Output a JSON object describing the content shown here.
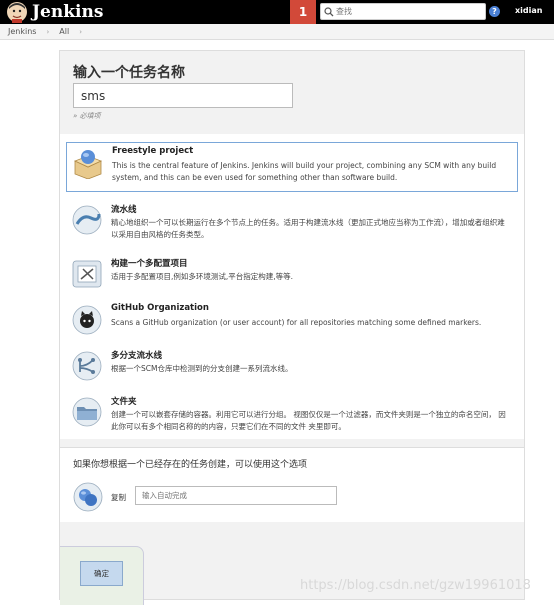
{
  "header": {
    "brand": "Jenkins",
    "notification_count": "1",
    "search_placeholder": "查找",
    "help": "?",
    "user": "xidian"
  },
  "breadcrumb": [
    "Jenkins",
    "All"
  ],
  "form": {
    "title": "输入一个任务名称",
    "name_value": "sms",
    "required_note": "» 必填项"
  },
  "job_types": [
    {
      "name": "Freestyle project",
      "description": "This is the central feature of Jenkins. Jenkins will build your project, combining any SCM with any build system, and this can be even used for something other than software build.",
      "icon": "freestyle-box-icon"
    },
    {
      "name": "流水线",
      "description": "精心地组织一个可以长期运行在多个节点上的任务。适用于构建流水线（更加正式地应当称为工作流），增加或者组织难以采用自由风格的任务类型。",
      "icon": "pipeline-icon"
    },
    {
      "name": "构建一个多配置项目",
      "description": "适用于多配置项目,例如多环境测试,平台指定构建,等等.",
      "icon": "multi-config-icon"
    },
    {
      "name": "GitHub Organization",
      "description": "Scans a GitHub organization (or user account) for all repositories matching some defined markers.",
      "icon": "github-icon"
    },
    {
      "name": "多分支流水线",
      "description": "根据一个SCM仓库中检测到的分支创建一系列流水线。",
      "icon": "multibranch-icon"
    },
    {
      "name": "文件夹",
      "description": "创建一个可以嵌套存储的容器。利用它可以进行分组。 视图仅仅是一个过滤器，而文件夹则是一个独立的命名空间， 因此你可以有多个相同名称的的内容，只要它们在不同的文件 夹里即可。",
      "icon": "folder-icon"
    }
  ],
  "copy": {
    "hint": "如果你想根据一个已经存在的任务创建，可以使用这个选项",
    "label": "复制",
    "placeholder": "输入自动完成"
  },
  "ok_label": "确定",
  "watermark": "https://blog.csdn.net/gzw19961018",
  "colors": {
    "header_bg": "#000000",
    "notification_bg": "#d24939",
    "selected_border": "#7aa7d9",
    "ok_button_bg": "#c5d9ee"
  }
}
